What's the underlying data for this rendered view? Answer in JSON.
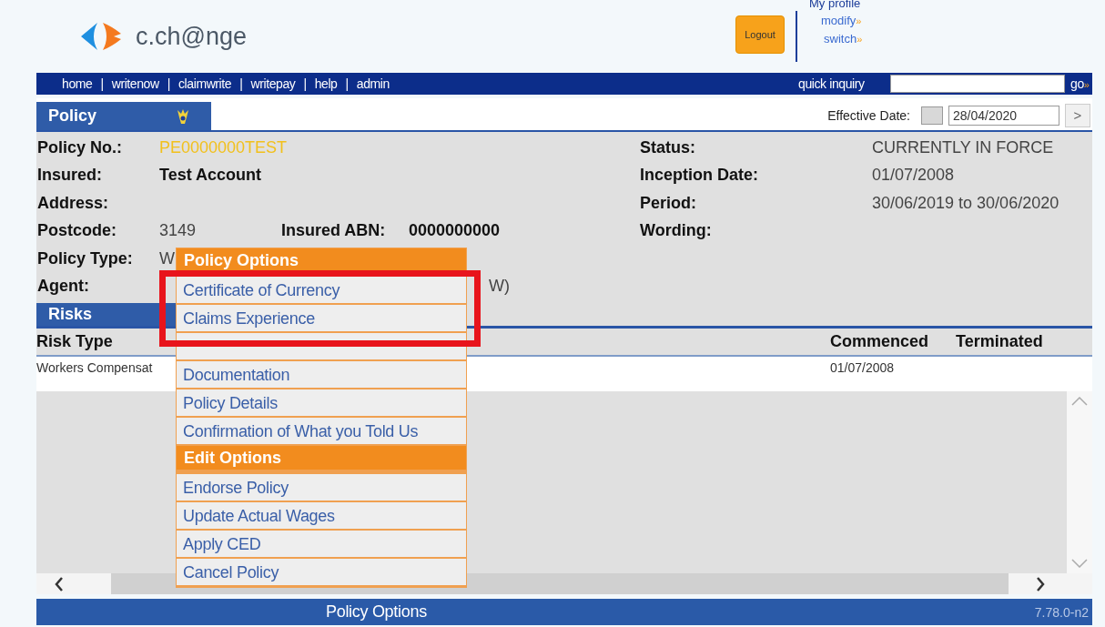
{
  "header": {
    "logo_text": "c.ch@nge",
    "logout": "Logout",
    "my_profile": "My profile",
    "links": [
      {
        "label": "modify",
        "arrow": "»"
      },
      {
        "label": "switch",
        "arrow": "»"
      }
    ]
  },
  "nav": {
    "items": [
      "home",
      "writenow",
      "claimwrite",
      "writepay",
      "help",
      "admin"
    ],
    "separator": "|",
    "quick_inquiry": "quick inquiry",
    "go": "go",
    "go_arrow": "»"
  },
  "policy_bar": {
    "tab": "Policy",
    "effective_label": "Effective Date:",
    "effective_value": "28/04/2020",
    "next": ">"
  },
  "details": {
    "left": [
      {
        "label": "Policy No.:",
        "value": "PE0000000TEST",
        "kind": "highlight"
      },
      {
        "label": "Insured:",
        "value": "Test Account",
        "kind": "bold"
      },
      {
        "label": "Address:"
      },
      {
        "label": "Postcode:",
        "value": "3149",
        "kind": "plain",
        "extra_label": "Insured ABN:",
        "extra_value": "0000000000"
      },
      {
        "label": "Policy Type:",
        "value": "W",
        "kind": "plain"
      },
      {
        "label": "Agent:",
        "tail": "W)"
      }
    ],
    "right": [
      {
        "label": "Status:",
        "value": "CURRENTLY IN FORCE"
      },
      {
        "label": "Inception Date:",
        "value": "01/07/2008"
      },
      {
        "label": "Period:",
        "value": "30/06/2019 to 30/06/2020"
      },
      {
        "label": "Wording:"
      }
    ]
  },
  "risks": {
    "title": "Risks",
    "columns": [
      "Risk Type",
      "Commenced",
      "Terminated"
    ],
    "rows": [
      {
        "risk_type": "Workers Compensat",
        "commenced": "01/07/2008"
      }
    ]
  },
  "footer": {
    "title": "Policy Options",
    "version": "7.78.0-n2"
  },
  "menu": {
    "sections": [
      {
        "title": "Policy Options",
        "items": [
          {
            "label": "Certificate of Currency"
          },
          {
            "label": "Claims Experience"
          },
          {
            "kind": "covered"
          },
          {
            "label": "Documentation"
          },
          {
            "label": "Policy Details"
          },
          {
            "label": "Confirmation of What you Told Us"
          }
        ]
      },
      {
        "title": "Edit Options",
        "items": [
          {
            "label": "Endorse Policy"
          },
          {
            "label": "Update Actual Wages"
          },
          {
            "label": "Apply CED"
          },
          {
            "label": "Cancel Policy"
          }
        ]
      }
    ]
  }
}
